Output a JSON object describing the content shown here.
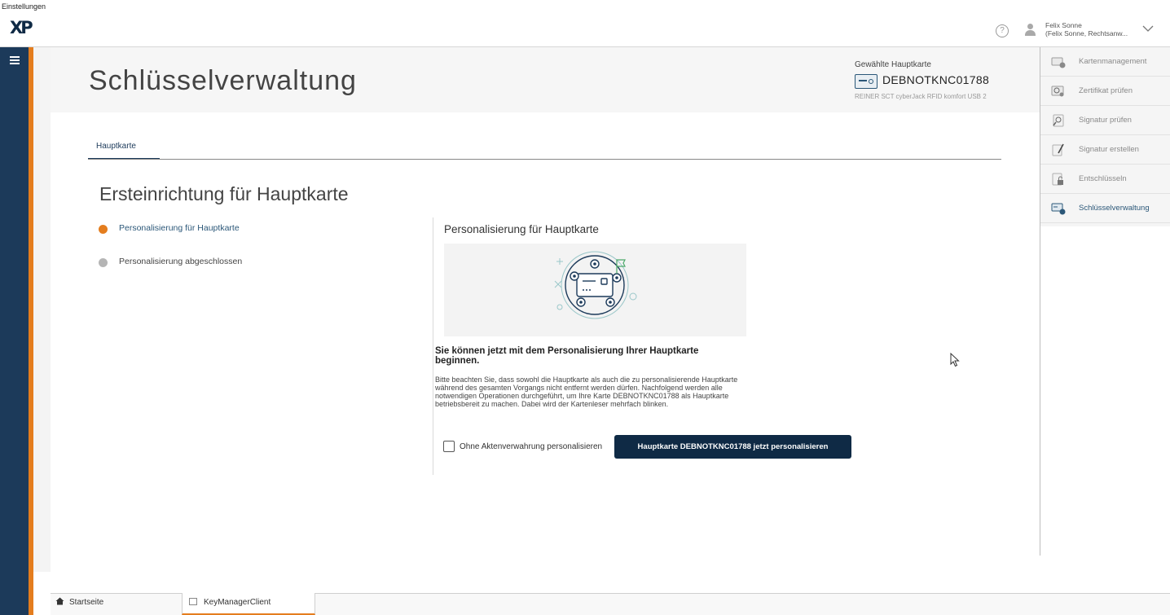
{
  "window": {
    "title": "Einstellungen"
  },
  "app": {
    "logo": "XP"
  },
  "header": {
    "user_name": "Felix Sonne",
    "user_detail": "(Felix Sonne, Rechtsanw...",
    "page_title": "Schlüsselverwaltung",
    "selected_card_label": "Gewählte Hauptkarte",
    "selected_card_id": "DEBNOTKNC01788",
    "card_reader": "REINER SCT cyberJack RFID komfort USB 2"
  },
  "tabs": [
    {
      "label": "Hauptkarte",
      "active": true
    }
  ],
  "section_title": "Ersteinrichtung für Hauptkarte",
  "steps": [
    {
      "label": "Personalisierung für Hauptkarte",
      "state": "active"
    },
    {
      "label": "Personalisierung abgeschlossen",
      "state": "pending"
    }
  ],
  "content": {
    "title": "Personalisierung für Hauptkarte",
    "heading": "Sie können jetzt mit dem Personalisierung Ihrer Hauptkarte beginnen.",
    "body": "Bitte beachten Sie, dass sowohl die Hauptkarte als auch die zu personalisierende Hauptkarte während des gesamten Vorgangs nicht entfernt werden dürfen. Nachfolgend werden alle notwendigen Operationen durchgeführt, um Ihre Karte DEBNOTKNC01788 als Hauptkarte betriebsbereit zu machen. Dabei wird der Kartenleser mehrfach blinken.",
    "checkbox_label": "Ohne Aktenverwahrung personalisieren",
    "checkbox_checked": false,
    "primary_button": "Hauptkarte DEBNOTKNC01788 jetzt personalisieren"
  },
  "right_menu": [
    {
      "label": "Kartenmanagement",
      "icon": "card-management-icon",
      "active": false
    },
    {
      "label": "Zertifikat prüfen",
      "icon": "certificate-icon",
      "active": false
    },
    {
      "label": "Signatur prüfen",
      "icon": "signature-check-icon",
      "active": false
    },
    {
      "label": "Signatur erstellen",
      "icon": "signature-create-icon",
      "active": false
    },
    {
      "label": "Entschlüsseln",
      "icon": "decrypt-icon",
      "active": false
    },
    {
      "label": "Schlüsselverwaltung",
      "icon": "key-management-icon",
      "active": true
    }
  ],
  "taskbar": {
    "home_label": "Startseite",
    "app_label": "KeyManagerClient"
  },
  "colors": {
    "navy": "#0f2a45",
    "rail": "#1c3a5a",
    "accent_orange": "#e47d1e",
    "link_blue": "#2b5778"
  }
}
